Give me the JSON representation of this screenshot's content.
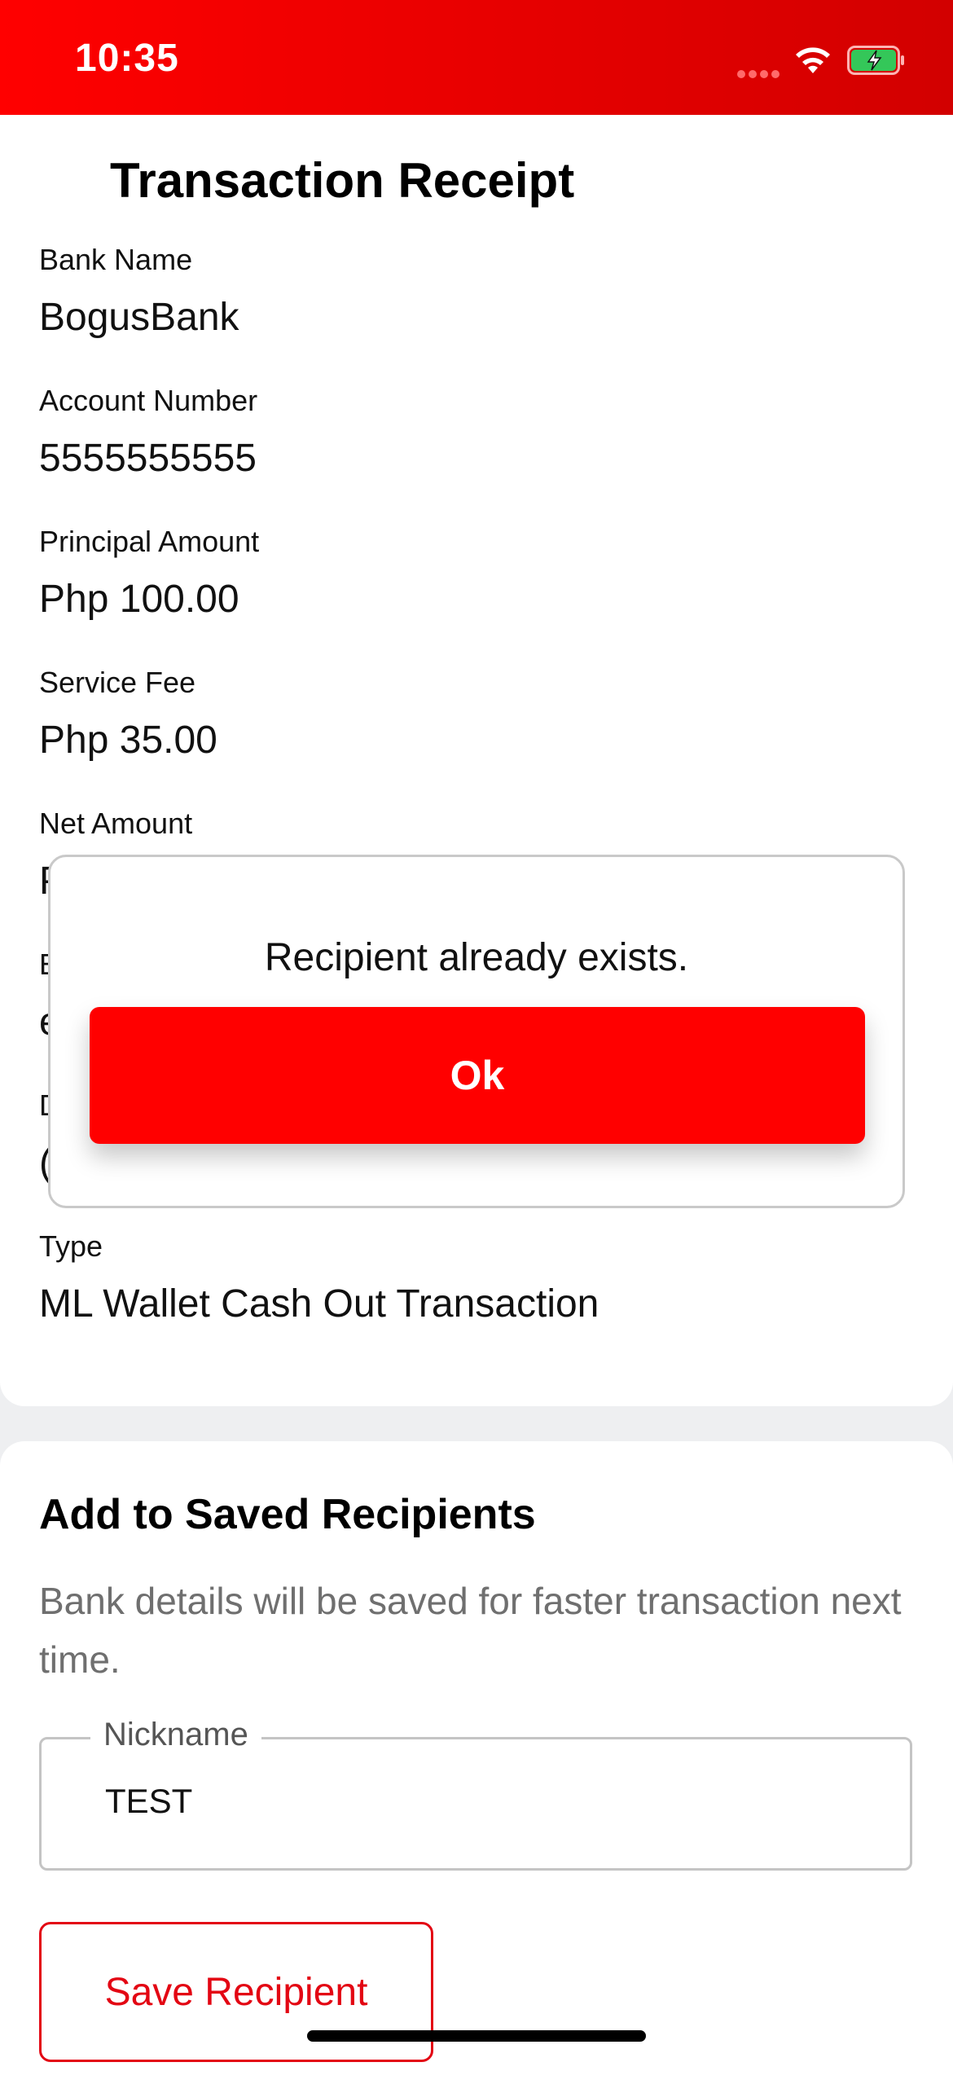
{
  "status_bar": {
    "time": "10:35",
    "color": "#ff0000"
  },
  "header": {
    "title": "Transaction Receipt"
  },
  "receipt": {
    "fields": [
      {
        "label": "Bank Name",
        "value": "BogusBank"
      },
      {
        "label": "Account Number",
        "value": "5555555555"
      },
      {
        "label": "Principal Amount",
        "value": "Php 100.00"
      },
      {
        "label": "Service Fee",
        "value": "Php 35.00"
      },
      {
        "label": "Net Amount",
        "value": "P"
      },
      {
        "label": "E",
        "value": "e"
      },
      {
        "label": "D",
        "value": "("
      },
      {
        "label": "Type",
        "value": "ML Wallet Cash Out Transaction"
      }
    ]
  },
  "saved_recipients": {
    "title": "Add to Saved Recipients",
    "description": "Bank details will be saved for faster transaction next time.",
    "nickname_label": "Nickname",
    "nickname_value": "TEST",
    "save_button": "Save Recipient"
  },
  "modal": {
    "message": "Recipient already exists.",
    "ok_button": "Ok"
  },
  "colors": {
    "accent": "#ff0000",
    "secondary_accent": "#e30613"
  },
  "icons": [
    "signal-icon",
    "wifi-icon",
    "battery-charging-icon"
  ]
}
